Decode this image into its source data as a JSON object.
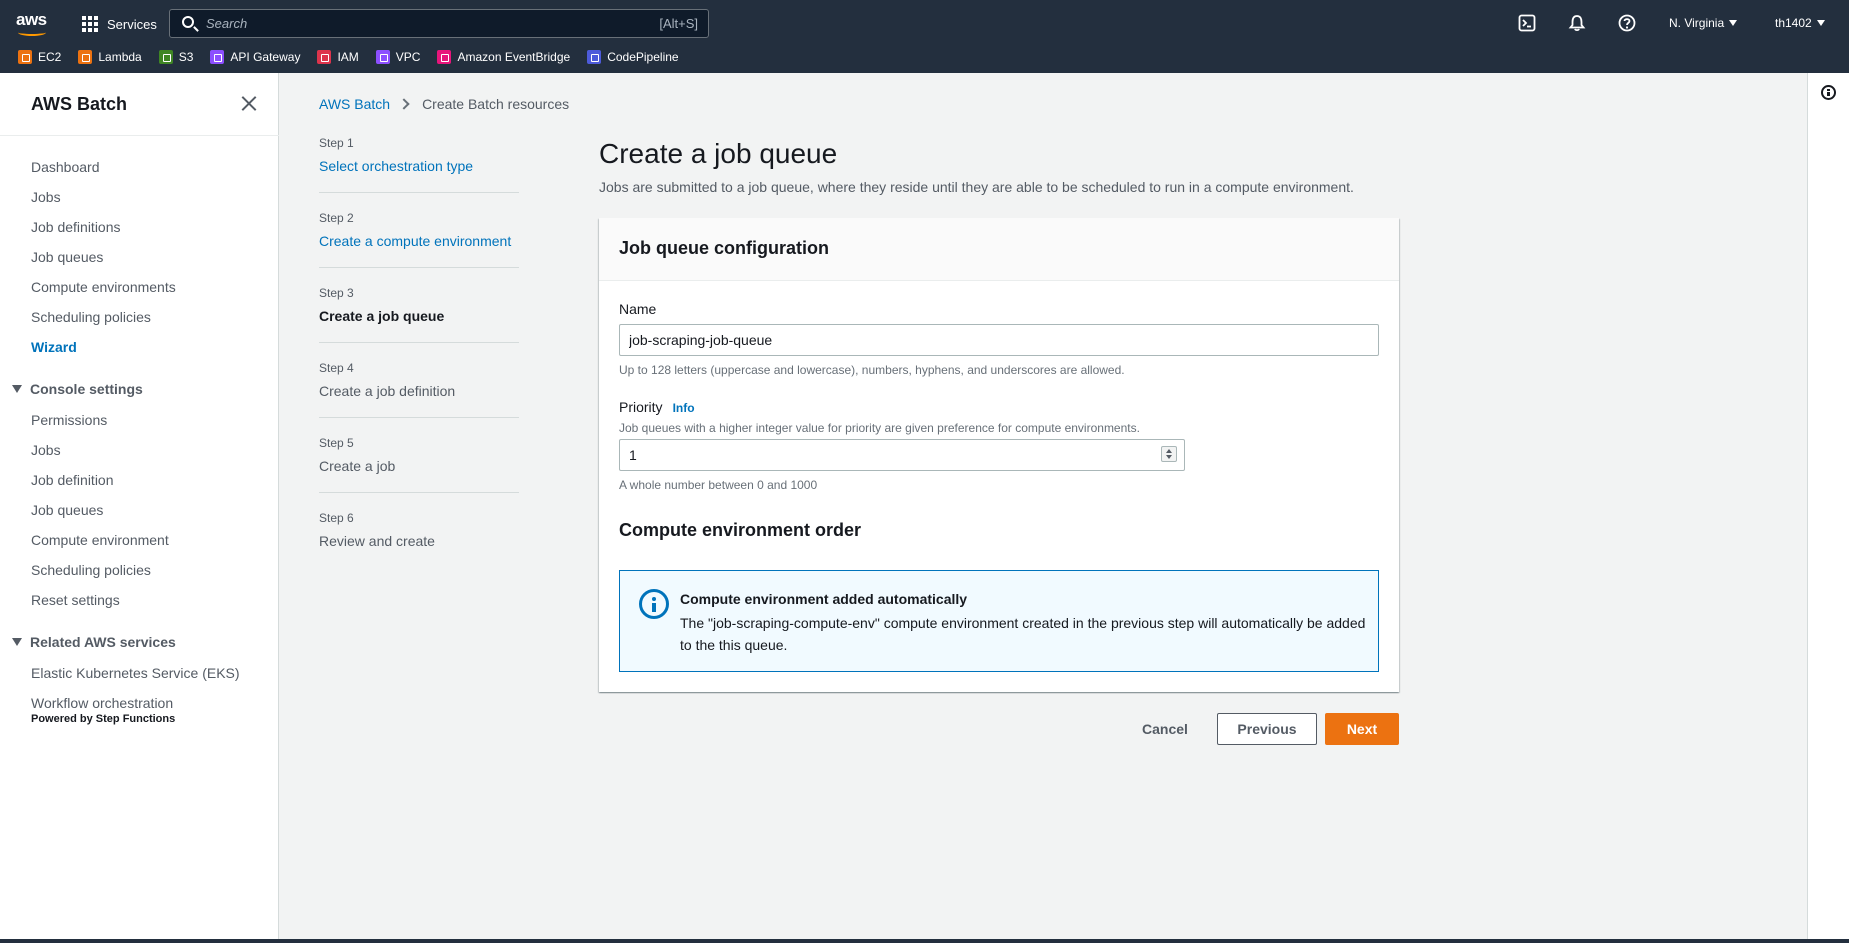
{
  "topnav": {
    "services_label": "Services",
    "search_placeholder": "Search",
    "search_shortcut": "[Alt+S]",
    "region": "N. Virginia",
    "user": "th1402",
    "favorites": [
      {
        "label": "EC2",
        "icon": "ec2-icon",
        "color": "#ec7211"
      },
      {
        "label": "Lambda",
        "icon": "lambda-icon",
        "color": "#ec7211"
      },
      {
        "label": "S3",
        "icon": "s3-icon",
        "color": "#3f8624"
      },
      {
        "label": "API Gateway",
        "icon": "api-gateway-icon",
        "color": "#8c4fff"
      },
      {
        "label": "IAM",
        "icon": "iam-icon",
        "color": "#dd344c"
      },
      {
        "label": "VPC",
        "icon": "vpc-icon",
        "color": "#8c4fff"
      },
      {
        "label": "Amazon EventBridge",
        "icon": "eventbridge-icon",
        "color": "#e7157b"
      },
      {
        "label": "CodePipeline",
        "icon": "codepipeline-icon",
        "color": "#4d5bda"
      }
    ]
  },
  "sidebar": {
    "title": "AWS Batch",
    "items": [
      "Dashboard",
      "Jobs",
      "Job definitions",
      "Job queues",
      "Compute environments",
      "Scheduling policies",
      "Wizard"
    ],
    "console_settings": {
      "title": "Console settings",
      "items": [
        "Permissions",
        "Jobs",
        "Job definition",
        "Job queues",
        "Compute environment",
        "Scheduling policies",
        "Reset settings"
      ]
    },
    "related": {
      "title": "Related AWS services",
      "items": [
        "Elastic Kubernetes Service (EKS)",
        "Workflow orchestration"
      ],
      "powered_by": "Powered by Step Functions"
    }
  },
  "breadcrumb": {
    "root": "AWS Batch",
    "current": "Create Batch resources"
  },
  "steps": [
    {
      "num": "Step 1",
      "title": "Select orchestration type"
    },
    {
      "num": "Step 2",
      "title": "Create a compute environment"
    },
    {
      "num": "Step 3",
      "title": "Create a job queue"
    },
    {
      "num": "Step 4",
      "title": "Create a job definition"
    },
    {
      "num": "Step 5",
      "title": "Create a job"
    },
    {
      "num": "Step 6",
      "title": "Review and create"
    }
  ],
  "main": {
    "title": "Create a job queue",
    "description": "Jobs are submitted to a job queue, where they reside until they are able to be scheduled to run in a compute environment.",
    "panel_title": "Job queue configuration",
    "name_label": "Name",
    "name_value": "job-scraping-job-queue",
    "name_hint": "Up to 128 letters (uppercase and lowercase), numbers, hyphens, and underscores are allowed.",
    "priority_label": "Priority",
    "priority_info": "Info",
    "priority_desc": "Job queues with a higher integer value for priority are given preference for compute environments.",
    "priority_value": "1",
    "priority_hint": "A whole number between 0 and 1000",
    "ce_order_title": "Compute environment order",
    "alert_title": "Compute environment added automatically",
    "alert_body": "The \"job-scraping-compute-env\" compute environment created in the previous step will automatically be added to the this queue."
  },
  "buttons": {
    "cancel": "Cancel",
    "previous": "Previous",
    "next": "Next"
  }
}
